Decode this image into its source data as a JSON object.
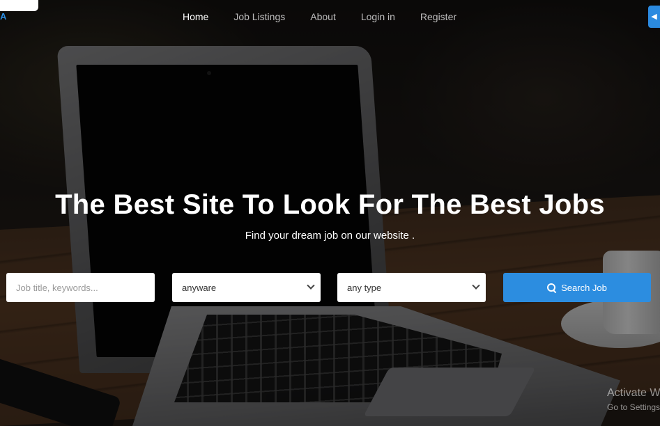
{
  "brand": {
    "logo_letter": "A"
  },
  "nav": {
    "items": [
      {
        "label": "Home"
      },
      {
        "label": "Job Listings"
      },
      {
        "label": "About"
      },
      {
        "label": "Login in"
      },
      {
        "label": "Register"
      }
    ],
    "active": "Home",
    "corner_icon": "arrow-left-icon"
  },
  "hero": {
    "title": "The Best Site To Look For The Best Jobs",
    "subtitle": "Find your dream job on our website ."
  },
  "search": {
    "keyword_placeholder": "Job title, keywords...",
    "location_value": "anyware",
    "type_value": "any type",
    "button_label": "Search Job",
    "button_icon": "search-icon"
  },
  "watermark": {
    "line1": "Activate W",
    "line2": "Go to Settings"
  },
  "colors": {
    "accent": "#2c8de0",
    "text_light": "#ffffff"
  }
}
